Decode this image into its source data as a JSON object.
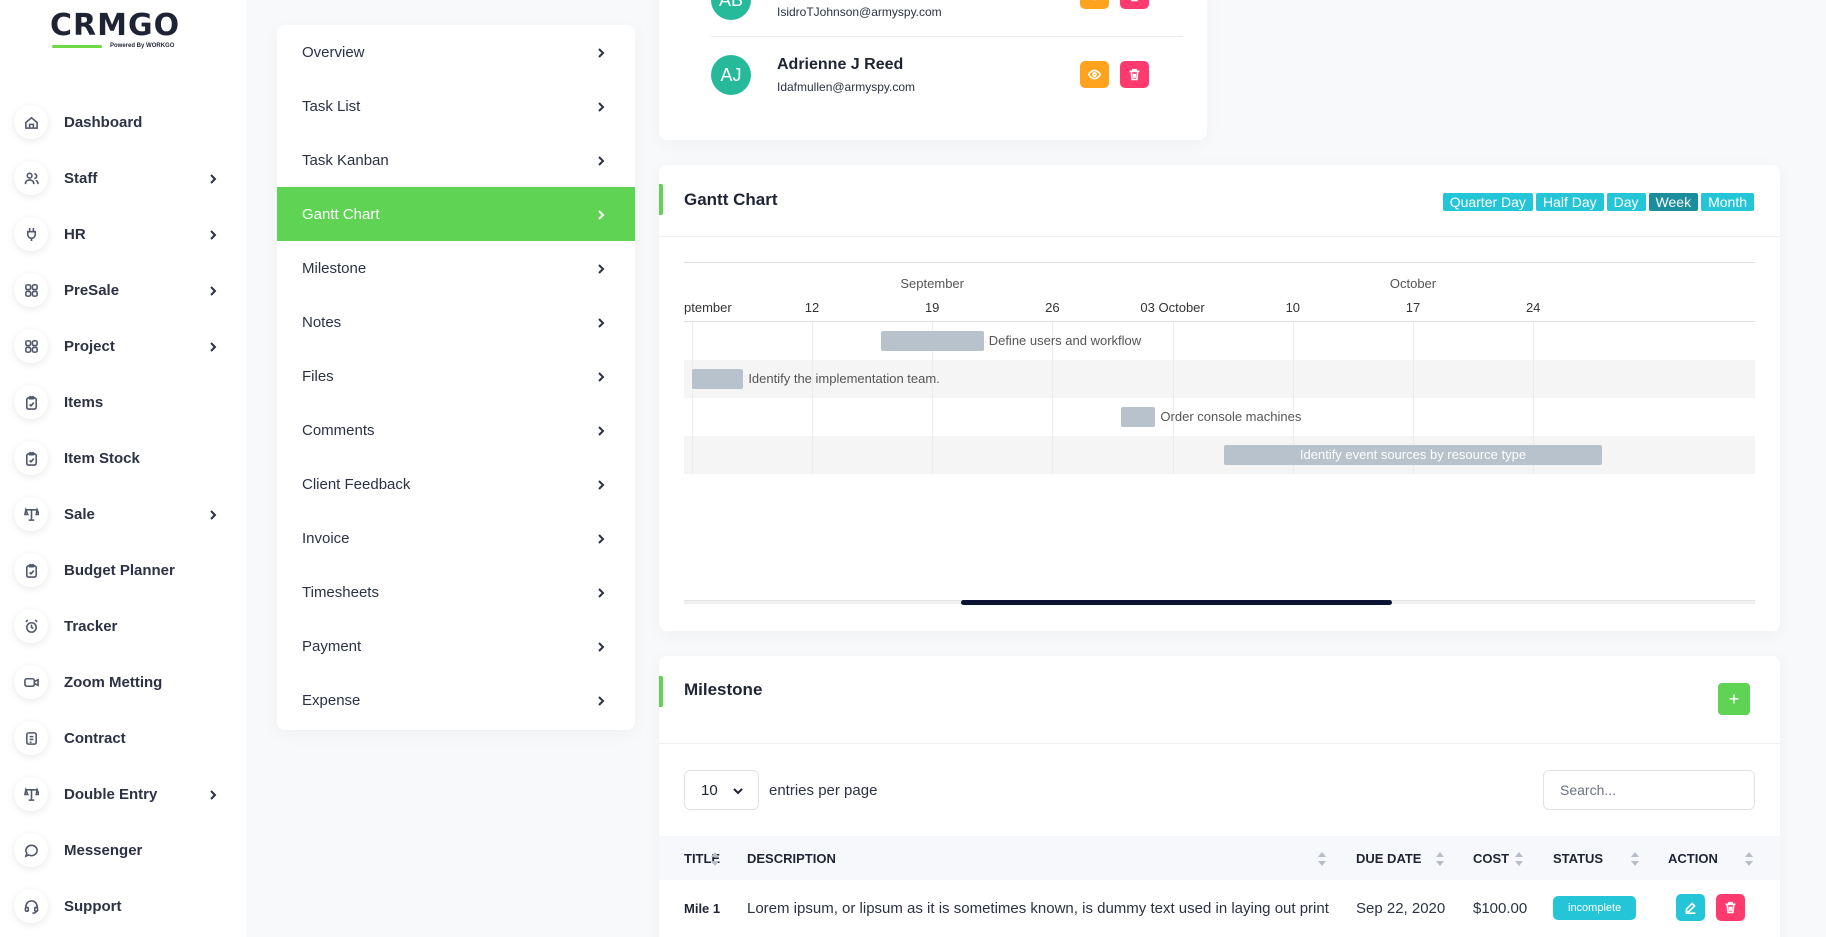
{
  "brand": {
    "logo_text": "CRMGO",
    "powered_by": "Powered By",
    "powered_brand": "WORKGO",
    "accent_color": "#6fd943"
  },
  "sidebar": {
    "items": [
      {
        "label": "Dashboard",
        "icon": "home-icon",
        "has_children": false
      },
      {
        "label": "Staff",
        "icon": "users-icon",
        "has_children": true
      },
      {
        "label": "HR",
        "icon": "plug-icon",
        "has_children": true
      },
      {
        "label": "PreSale",
        "icon": "grid-icon",
        "has_children": true
      },
      {
        "label": "Project",
        "icon": "grid-icon",
        "has_children": true
      },
      {
        "label": "Items",
        "icon": "clipboard-icon",
        "has_children": false
      },
      {
        "label": "Item Stock",
        "icon": "clipboard-icon",
        "has_children": false
      },
      {
        "label": "Sale",
        "icon": "scale-icon",
        "has_children": true
      },
      {
        "label": "Budget Planner",
        "icon": "clipboard-icon",
        "has_children": false
      },
      {
        "label": "Tracker",
        "icon": "alarm-icon",
        "has_children": false
      },
      {
        "label": "Zoom Metting",
        "icon": "video-icon",
        "has_children": false
      },
      {
        "label": "Contract",
        "icon": "contract-icon",
        "has_children": false
      },
      {
        "label": "Double Entry",
        "icon": "scale-icon",
        "has_children": true
      },
      {
        "label": "Messenger",
        "icon": "chat-icon",
        "has_children": false
      },
      {
        "label": "Support",
        "icon": "headset-icon",
        "has_children": false
      }
    ]
  },
  "submenu": {
    "items": [
      {
        "label": "Overview",
        "active": false
      },
      {
        "label": "Task List",
        "active": false
      },
      {
        "label": "Task Kanban",
        "active": false
      },
      {
        "label": "Gantt Chart",
        "active": true
      },
      {
        "label": "Milestone",
        "active": false
      },
      {
        "label": "Notes",
        "active": false
      },
      {
        "label": "Files",
        "active": false
      },
      {
        "label": "Comments",
        "active": false
      },
      {
        "label": "Client Feedback",
        "active": false
      },
      {
        "label": "Invoice",
        "active": false
      },
      {
        "label": "Timesheets",
        "active": false
      },
      {
        "label": "Payment",
        "active": false
      },
      {
        "label": "Expense",
        "active": false
      }
    ]
  },
  "team": {
    "members": [
      {
        "initials": "AB",
        "name": "",
        "email": "IsidroTJohnson@armyspy.com"
      },
      {
        "initials": "AJ",
        "name": "Adrienne J Reed",
        "email": "Idafmullen@armyspy.com"
      }
    ]
  },
  "gantt": {
    "title": "Gantt Chart",
    "view_modes": [
      {
        "label": "Quarter Day",
        "active": false
      },
      {
        "label": "Half Day",
        "active": false
      },
      {
        "label": "Day",
        "active": false
      },
      {
        "label": "Week",
        "active": true
      },
      {
        "label": "Month",
        "active": false
      }
    ],
    "upper_labels": [
      "September",
      "October"
    ],
    "lower_labels": [
      "ptember",
      "12",
      "19",
      "26",
      "03 October",
      "10",
      "17",
      "24"
    ],
    "tasks": [
      {
        "name": "Define users and workflow",
        "start": "2020-09-16",
        "end": "2020-09-22"
      },
      {
        "name": "Identify the implementation team.",
        "start": "2020-09-05",
        "end": "2020-09-08"
      },
      {
        "name": "Order console machines",
        "start": "2020-09-30",
        "end": "2020-10-02"
      },
      {
        "name": "Identify event sources by resource type",
        "start": "2020-10-06",
        "end": "2020-10-28"
      }
    ]
  },
  "milestone": {
    "title": "Milestone",
    "add_label": "+",
    "entries_value": "10",
    "entries_text": "entries per page",
    "search_placeholder": "Search...",
    "columns": [
      "TITLE",
      "DESCRIPTION",
      "DUE DATE",
      "COST",
      "STATUS",
      "ACTION"
    ],
    "rows": [
      {
        "title": "Mile 1",
        "description": "Lorem ipsum, or lipsum as it is sometimes known, is dummy text used in laying out print",
        "due_date": "Sep 22, 2020",
        "cost": "$100.00",
        "status": "incomplete"
      }
    ]
  },
  "colors": {
    "green": "#5fd354",
    "cyan": "#24c5d6",
    "orange": "#ffa21d",
    "red": "#ff3a6e",
    "teal_avatar": "#26b99a"
  }
}
